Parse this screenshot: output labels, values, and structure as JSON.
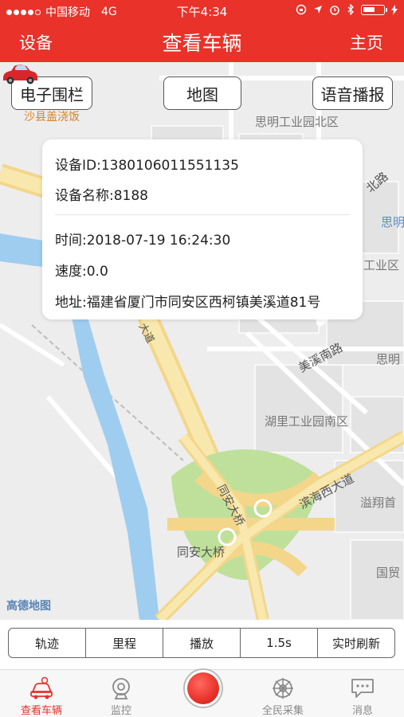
{
  "status_bar": {
    "carrier": "中国移动",
    "network": "4G",
    "time": "下午4:34"
  },
  "nav": {
    "left": "设备",
    "title": "查看车辆",
    "right": "主页"
  },
  "map": {
    "buttons": {
      "fence": "电子围栏",
      "map": "地图",
      "voice": "语音播报"
    },
    "labels": {
      "restaurant": "沙县盖浇饭",
      "park_north": "思明工业园北区",
      "road_partial_1": "北路",
      "siming_right": "思明",
      "industrial_partial": "工业区",
      "meixi_road": "美溪南路",
      "siming_right2": "思明",
      "huli_south": "湖里工业园南区",
      "binhai": "滨海西大道",
      "tongan_bridge_vertical": "同安大桥",
      "tongan_bridge": "同安大桥",
      "yixiang": "溢翔首",
      "guomao": "国贸",
      "dadao_partial": "大道",
      "gaode": "高德地图"
    }
  },
  "info": {
    "device_id": "设备ID:1380106011551135",
    "device_name": "设备名称:8188",
    "time": "时间:2018-07-19 16:24:30",
    "speed": "速度:0.0",
    "address": "地址:福建省厦门市同安区西柯镇美溪道81号"
  },
  "controls": [
    "轨迹",
    "里程",
    "播放",
    "1.5s",
    "实时刷新"
  ],
  "tabs": {
    "view_vehicle": "查看车辆",
    "monitor": "监控",
    "crowd_collect": "全民采集",
    "messages": "消息"
  },
  "colors": {
    "brand_red": "#e8322a",
    "map_bg": "#ededed",
    "road_yellow": "#f6dd8e",
    "water_blue": "#9fcdf0",
    "park_green": "#bfe09a"
  }
}
